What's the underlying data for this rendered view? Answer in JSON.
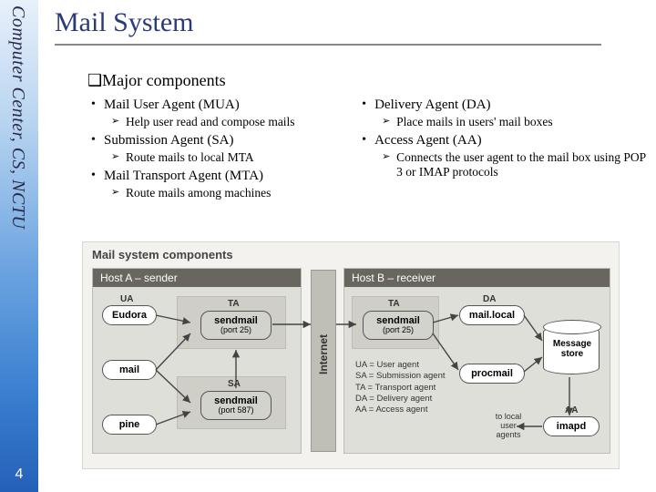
{
  "sidebar": {
    "org": "Computer Center, CS, NCTU"
  },
  "slide_number": "4",
  "title": "Mail System",
  "section": {
    "marker": "❑",
    "heading": "Major components"
  },
  "left": [
    {
      "label": "Mail User Agent (MUA)",
      "sub": "Help user read and compose mails"
    },
    {
      "label": "Submission Agent (SA)",
      "sub": "Route mails to local MTA"
    },
    {
      "label": "Mail Transport Agent (MTA)",
      "sub": "Route mails among machines"
    }
  ],
  "right": [
    {
      "label": "Delivery Agent (DA)",
      "sub": "Place mails in users' mail boxes"
    },
    {
      "label": "Access Agent (AA)",
      "sub": "Connects the user agent to the mail box using POP 3 or IMAP protocols"
    }
  ],
  "diagram": {
    "title": "Mail system components",
    "hostA": "Host A – sender",
    "hostB": "Host B – receiver",
    "internet": "Internet",
    "roles": {
      "ua": "UA",
      "ta": "TA",
      "sa": "SA",
      "da": "DA",
      "aa": "AA"
    },
    "a_ua": [
      "Eudora",
      "mail",
      "pine"
    ],
    "a_ta": "sendmail",
    "a_ta_port": "(port 25)",
    "a_sa": "sendmail",
    "a_sa_port": "(port 587)",
    "b_ta": "sendmail",
    "b_ta_port": "(port 25)",
    "b_da": [
      "mail.local",
      "procmail"
    ],
    "b_aa": "imapd",
    "store": "Message store",
    "legend": [
      "UA = User agent",
      "SA = Submission agent",
      "TA = Transport agent",
      "DA = Delivery agent",
      "AA = Access agent"
    ],
    "tolocal": "to local user agents"
  }
}
